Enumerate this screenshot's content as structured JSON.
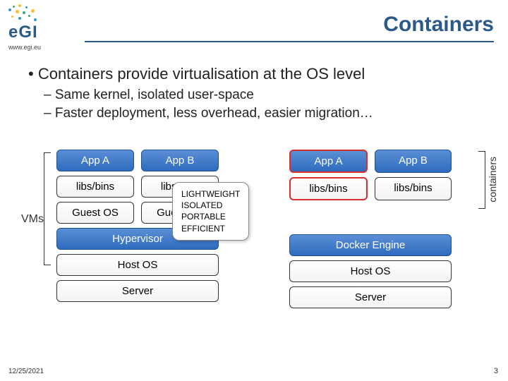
{
  "header": {
    "logo_text": "eGI",
    "logo_url": "www.egi.eu",
    "title": "Containers"
  },
  "bullets": {
    "main": "• Containers provide virtualisation at the OS level",
    "sub1": "– Same kernel, isolated user-space",
    "sub2": "– Faster deployment, less overhead, easier migration…"
  },
  "labels": {
    "vms": "VMs",
    "containers": "containers"
  },
  "left_stack": {
    "app_a": "App A",
    "app_b": "App B",
    "libs1": "libs/bins",
    "libs2": "libs/bins",
    "guest1": "Guest OS",
    "guest2": "Guest OS",
    "hypervisor": "Hypervisor",
    "host_os": "Host OS",
    "server": "Server"
  },
  "right_stack": {
    "app_a": "App A",
    "app_b": "App B",
    "libs1": "libs/bins",
    "libs2": "libs/bins",
    "engine": "Docker Engine",
    "host_os": "Host OS",
    "server": "Server"
  },
  "callout": {
    "l1": "LIGHTWEIGHT",
    "l2": "ISOLATED",
    "l3": "PORTABLE",
    "l4": "EFFICIENT"
  },
  "footer": {
    "date": "12/25/2021",
    "page": "3"
  }
}
